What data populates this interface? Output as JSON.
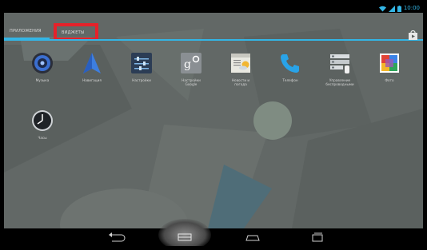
{
  "status_bar": {
    "time": "10:00",
    "icons": [
      "wifi-icon",
      "signal-icon",
      "battery-icon"
    ],
    "accent": "#33b5e5"
  },
  "tabs": [
    {
      "label": "ПРИЛОЖЕНИЯ",
      "selected": true
    },
    {
      "label": "ВИДЖЕТЫ",
      "selected": false,
      "highlight_color": "#e5222a"
    }
  ],
  "store_button": {
    "icon": "play-store-icon"
  },
  "apps": [
    {
      "label": "Музыка",
      "icon": "music-icon"
    },
    {
      "label": "Навигация",
      "icon": "navigation-icon"
    },
    {
      "label": "Настройки",
      "icon": "settings-icon"
    },
    {
      "label": "Настройки\nGoogle",
      "icon": "google-settings-icon"
    },
    {
      "label": "Новости и\nпогода",
      "icon": "news-weather-icon"
    },
    {
      "label": "Телефон",
      "icon": "phone-icon"
    },
    {
      "label": "Управление\nбеспроводными",
      "icon": "wireless-icon"
    },
    {
      "label": "Фото",
      "icon": "photos-icon"
    },
    {
      "label": "Часы",
      "icon": "clock-icon"
    }
  ],
  "nav_bar": {
    "buttons": [
      "back-icon",
      "home-icon",
      "recent-apps-icon",
      "menu-icon"
    ]
  }
}
